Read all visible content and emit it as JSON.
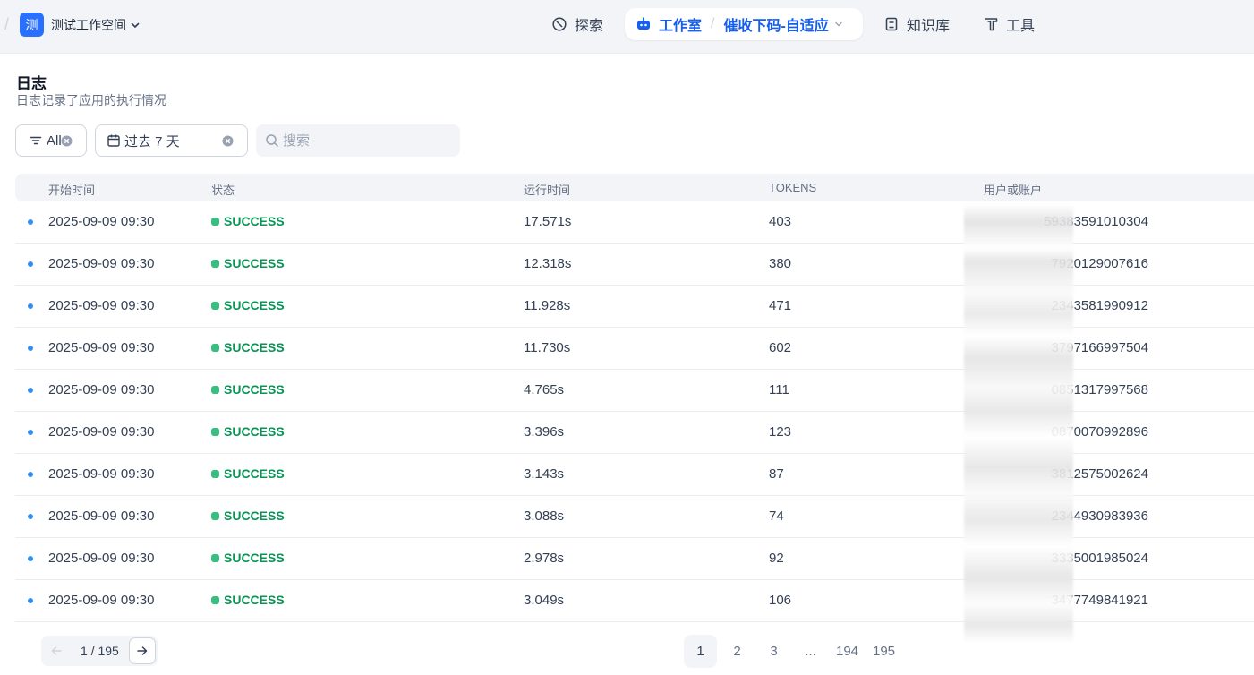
{
  "topbar": {
    "workspace_logo": "测",
    "workspace_name": "测试工作空间",
    "nav": {
      "explore": "探索",
      "studio": "工作室",
      "app_name": "催收下码-自适应",
      "knowledge": "知识库",
      "tools": "工具"
    }
  },
  "header": {
    "title": "日志",
    "description": "日志记录了应用的执行情况"
  },
  "filters": {
    "status": "All",
    "period": "过去 7 天",
    "search_placeholder": "搜索"
  },
  "table": {
    "columns": [
      "开始时间",
      "状态",
      "运行时间",
      "TOKENS",
      "用户或账户"
    ],
    "rows": [
      {
        "start": "2025-09-09 09:30",
        "status": "SUCCESS",
        "runtime": "17.571s",
        "tokens": "403",
        "user": "59383591010304"
      },
      {
        "start": "2025-09-09 09:30",
        "status": "SUCCESS",
        "runtime": "12.318s",
        "tokens": "380",
        "user": "7920129007616"
      },
      {
        "start": "2025-09-09 09:30",
        "status": "SUCCESS",
        "runtime": "11.928s",
        "tokens": "471",
        "user": "2343581990912"
      },
      {
        "start": "2025-09-09 09:30",
        "status": "SUCCESS",
        "runtime": "11.730s",
        "tokens": "602",
        "user": "3797166997504"
      },
      {
        "start": "2025-09-09 09:30",
        "status": "SUCCESS",
        "runtime": "4.765s",
        "tokens": "111",
        "user": "0851317997568"
      },
      {
        "start": "2025-09-09 09:30",
        "status": "SUCCESS",
        "runtime": "3.396s",
        "tokens": "123",
        "user": "0870070992896"
      },
      {
        "start": "2025-09-09 09:30",
        "status": "SUCCESS",
        "runtime": "3.143s",
        "tokens": "87",
        "user": "3812575002624"
      },
      {
        "start": "2025-09-09 09:30",
        "status": "SUCCESS",
        "runtime": "3.088s",
        "tokens": "74",
        "user": "2344930983936"
      },
      {
        "start": "2025-09-09 09:30",
        "status": "SUCCESS",
        "runtime": "2.978s",
        "tokens": "92",
        "user": "3335001985024"
      },
      {
        "start": "2025-09-09 09:30",
        "status": "SUCCESS",
        "runtime": "3.049s",
        "tokens": "106",
        "user": "3477749841921"
      }
    ]
  },
  "pagination": {
    "current": "1",
    "indicator": "1 / 195",
    "pages": [
      "1",
      "2",
      "3",
      "...",
      "194",
      "195"
    ]
  },
  "colors": {
    "accent": "#155eef",
    "success": "#079455",
    "dot": "#2e90fa"
  }
}
